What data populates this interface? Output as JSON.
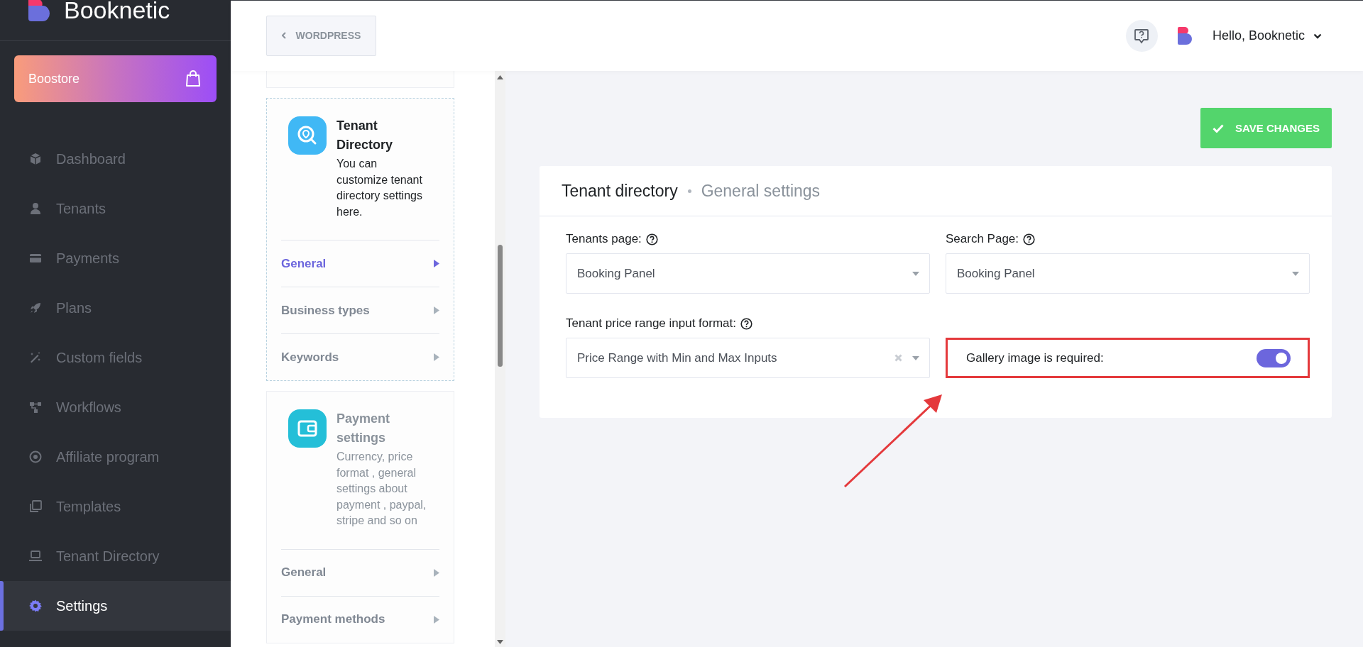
{
  "sidebar": {
    "brand": "Booknetic",
    "promo": "Boostore",
    "items": [
      {
        "label": "Dashboard",
        "selected": false
      },
      {
        "label": "Tenants",
        "selected": false
      },
      {
        "label": "Payments",
        "selected": false
      },
      {
        "label": "Plans",
        "selected": false
      },
      {
        "label": "Custom fields",
        "selected": false
      },
      {
        "label": "Workflows",
        "selected": false
      },
      {
        "label": "Affiliate program",
        "selected": false
      },
      {
        "label": "Templates",
        "selected": false
      },
      {
        "label": "Tenant Directory",
        "selected": false
      },
      {
        "label": "Settings",
        "selected": true
      }
    ]
  },
  "header": {
    "back_button": "WORDPRESS",
    "greeting": "Hello, Booknetic"
  },
  "settings_nav": {
    "cards": [
      {
        "title": "Tenant Directory",
        "description": "You can customize tenant directory settings here.",
        "selected": true,
        "links": [
          {
            "label": "General",
            "selected": true
          },
          {
            "label": "Business types",
            "selected": false
          },
          {
            "label": "Keywords",
            "selected": false
          }
        ]
      },
      {
        "title": "Payment settings",
        "description": "Currency, price format , general settings about payment , paypal, stripe and so on",
        "selected": false,
        "links": [
          {
            "label": "General",
            "selected": false
          },
          {
            "label": "Payment methods",
            "selected": false
          }
        ]
      }
    ]
  },
  "save_button": "SAVE CHANGES",
  "panel": {
    "title": "Tenant directory",
    "subtitle": "General settings",
    "fields": [
      {
        "kind": "select",
        "label": "Tenants page:",
        "value": "Booking Panel",
        "clearable": false
      },
      {
        "kind": "select",
        "label": "Search Page:",
        "value": "Booking Panel",
        "clearable": false
      },
      {
        "kind": "select",
        "label": "Tenant price range input format:",
        "value": "Price Range with Min and Max Inputs",
        "clearable": true
      },
      {
        "kind": "toggle",
        "label": "Gallery image is required:",
        "on": true,
        "highlighted": true
      }
    ]
  }
}
